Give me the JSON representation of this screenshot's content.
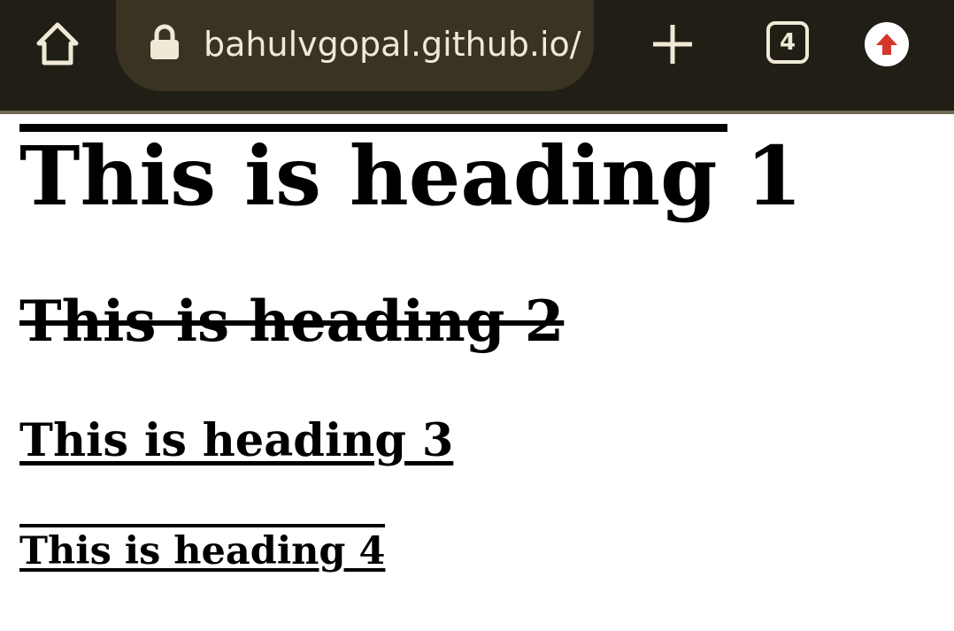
{
  "browser": {
    "url": "bahulvgopal.github.io/",
    "tab_count": "4",
    "icons": {
      "home": "home-icon",
      "lock": "lock-icon",
      "new_tab": "plus-icon",
      "tabs": "tab-switcher-icon",
      "update": "update-arrow-icon"
    },
    "colors": {
      "toolbar_bg": "#211e16",
      "url_bar_bg": "#3a3323",
      "icon_fg": "#efe9d6",
      "update_arrow": "#d6352b"
    }
  },
  "page": {
    "heading1": "This is heading 1",
    "heading2": "This is heading 2",
    "heading3": "This is heading 3",
    "heading4": "This is heading 4"
  }
}
